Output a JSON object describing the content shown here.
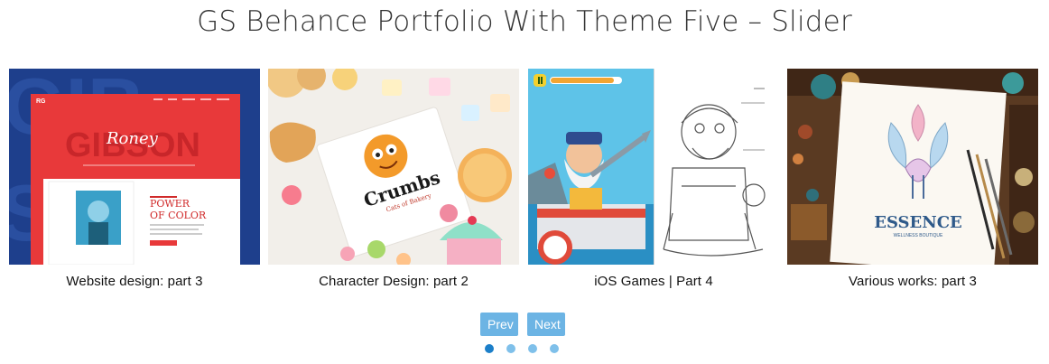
{
  "page": {
    "title": "GS Behance Portfolio With Theme Five – Slider"
  },
  "slides": [
    {
      "caption": "Website design: part 3",
      "thumb_text": {
        "brand": "RG",
        "hero": "GIBSON",
        "script": "Roney",
        "headline_1": "POWER",
        "headline_2": "OF COLOR"
      }
    },
    {
      "caption": "Character Design: part 2",
      "thumb_text": {
        "brand": "Crumbs",
        "tagline": "Cats of Bakery"
      }
    },
    {
      "caption": "iOS Games | Part 4",
      "thumb_text": {}
    },
    {
      "caption": "Various works: part 3",
      "thumb_text": {
        "brand": "ESSENCE",
        "tagline": "WELLNESS BOUTIQUE"
      }
    }
  ],
  "nav": {
    "prev_label": "Prev",
    "next_label": "Next"
  },
  "pagination": {
    "count": 4,
    "active": 1
  },
  "colors": {
    "button": "#6cb4e4",
    "dot": "#7fc0ea",
    "dot_active": "#1c7fc9"
  }
}
